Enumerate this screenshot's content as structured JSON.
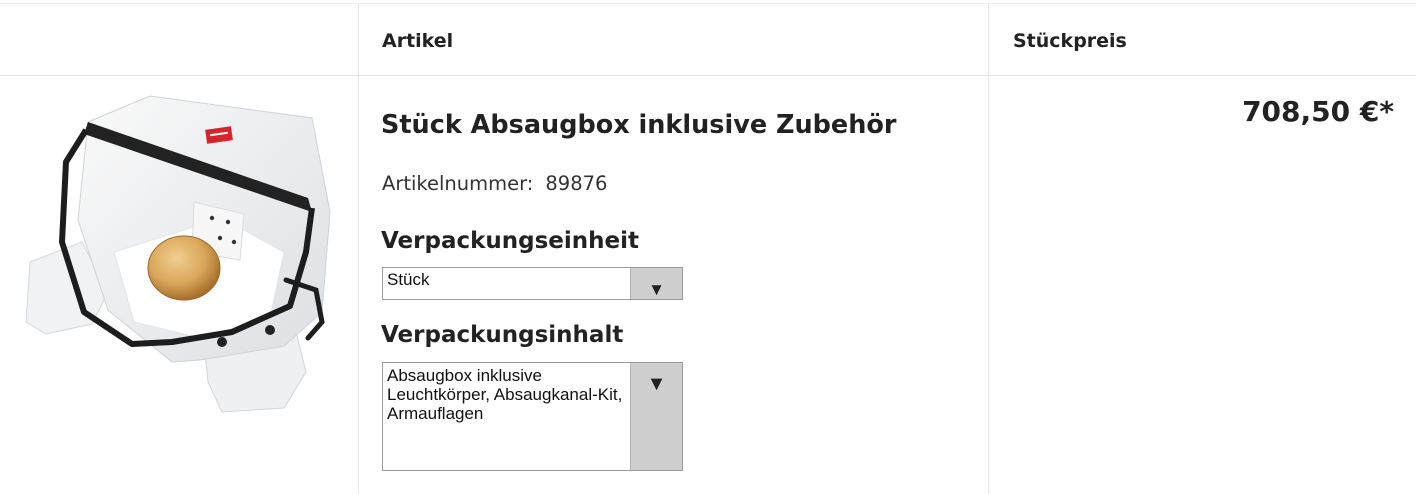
{
  "table": {
    "headers": {
      "artikel": "Artikel",
      "stueckpreis": "Stückpreis"
    }
  },
  "product": {
    "title": "Stück Absaugbox inklusive Zubehör",
    "artikelnummer_label": "Artikelnummer:",
    "artikelnummer_value": "89876",
    "price": "708,50 €*",
    "image_alt": "Absaugbox product image"
  },
  "verpackungseinheit": {
    "label": "Verpackungseinheit",
    "selected": "Stück",
    "icon": "dropdown-arrow-icon"
  },
  "verpackungsinhalt": {
    "label": "Verpackungsinhalt",
    "selected": "Absaugbox inklusive Leuchtkörper, Absaugkanal-Kit, Armauflagen",
    "icon": "dropdown-arrow-icon"
  },
  "colors": {
    "text": "#222222",
    "border": "#e6e6e6",
    "select_button": "#cfcfcf",
    "logo_red": "#d8232a"
  }
}
